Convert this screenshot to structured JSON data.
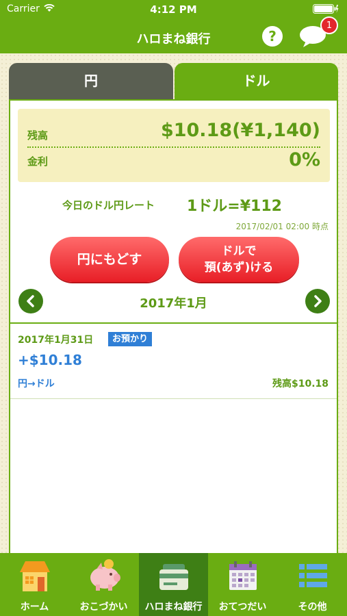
{
  "status_bar": {
    "carrier": "Carrier",
    "time": "4:12 PM"
  },
  "header": {
    "title": "ハロまね銀行",
    "help_label": "?",
    "notification_count": "1"
  },
  "tabs": {
    "yen": "円",
    "dollar": "ドル",
    "active": "dollar"
  },
  "balance": {
    "label": "残高",
    "value": "$10.18(¥1,140)",
    "interest_label": "金利",
    "interest_value": "0%"
  },
  "rate": {
    "label": "今日のドル円レート",
    "value": "1ドル=¥112",
    "timestamp": "2017/02/01 02:00 時点"
  },
  "actions": {
    "return_yen": "円にもどす",
    "deposit_line1": "ドルで",
    "deposit_line2": "預(あず)ける"
  },
  "month_nav": {
    "label": "2017年1月"
  },
  "transactions": [
    {
      "date": "2017年1月31日",
      "badge": "お預かり",
      "amount": "+$10.18",
      "type": "円→ドル",
      "balance": "残高$10.18"
    }
  ],
  "tabbar": [
    {
      "label": "ホーム",
      "icon": "house-icon"
    },
    {
      "label": "おこづかい",
      "icon": "piggy-bank-icon"
    },
    {
      "label": "ハロまね銀行",
      "icon": "bank-card-icon",
      "active": true
    },
    {
      "label": "おてつだい",
      "icon": "calendar-icon"
    },
    {
      "label": "その他",
      "icon": "list-icon"
    }
  ],
  "colors": {
    "brand_green": "#6aad12",
    "dark_green": "#3e7f15",
    "accent_red": "#e81e26",
    "deposit_blue": "#2f7fd6"
  }
}
